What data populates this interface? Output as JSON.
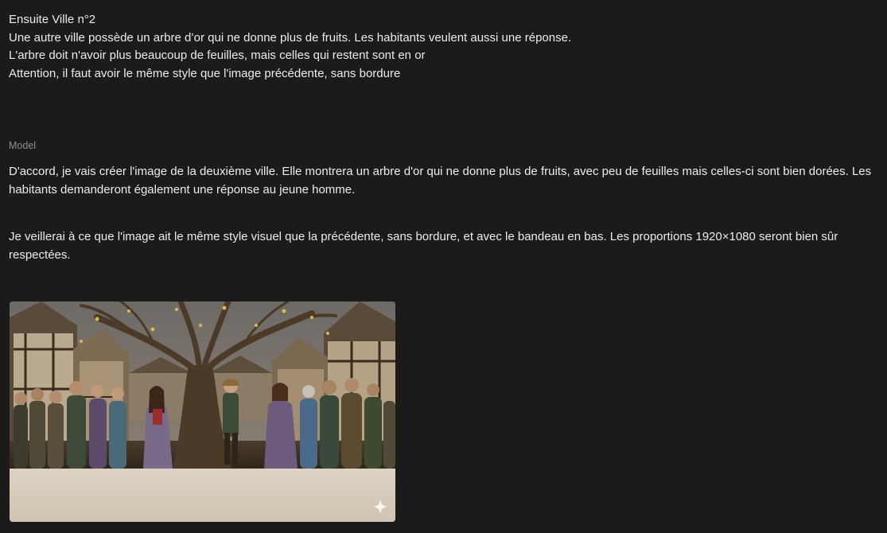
{
  "user_message": {
    "lines": [
      "Ensuite Ville n°2",
      "Une autre ville possède un arbre d’or qui ne donne plus de fruits. Les habitants veulent aussi une réponse.",
      "L'arbre doit n'avoir plus beaucoup de feuilles, mais celles qui restent sont en or",
      "Attention, il faut avoir le même style que l'image précédente, sans bordure"
    ]
  },
  "model": {
    "label": "Model",
    "paragraphs": [
      "D'accord, je vais créer l'image de la deuxième ville. Elle montrera un arbre d'or qui ne donne plus de fruits, avec peu de feuilles mais celles-ci sont bien dorées. Les habitants demanderont également une réponse au jeune homme.",
      "Je veillerai à ce que l'image ait le même style visuel que la précédente, sans bordure, et avec le bandeau en bas. Les proportions 1920×1080 seront bien sûr respectées."
    ]
  },
  "generated_image": {
    "icon": "sparkle-icon"
  }
}
